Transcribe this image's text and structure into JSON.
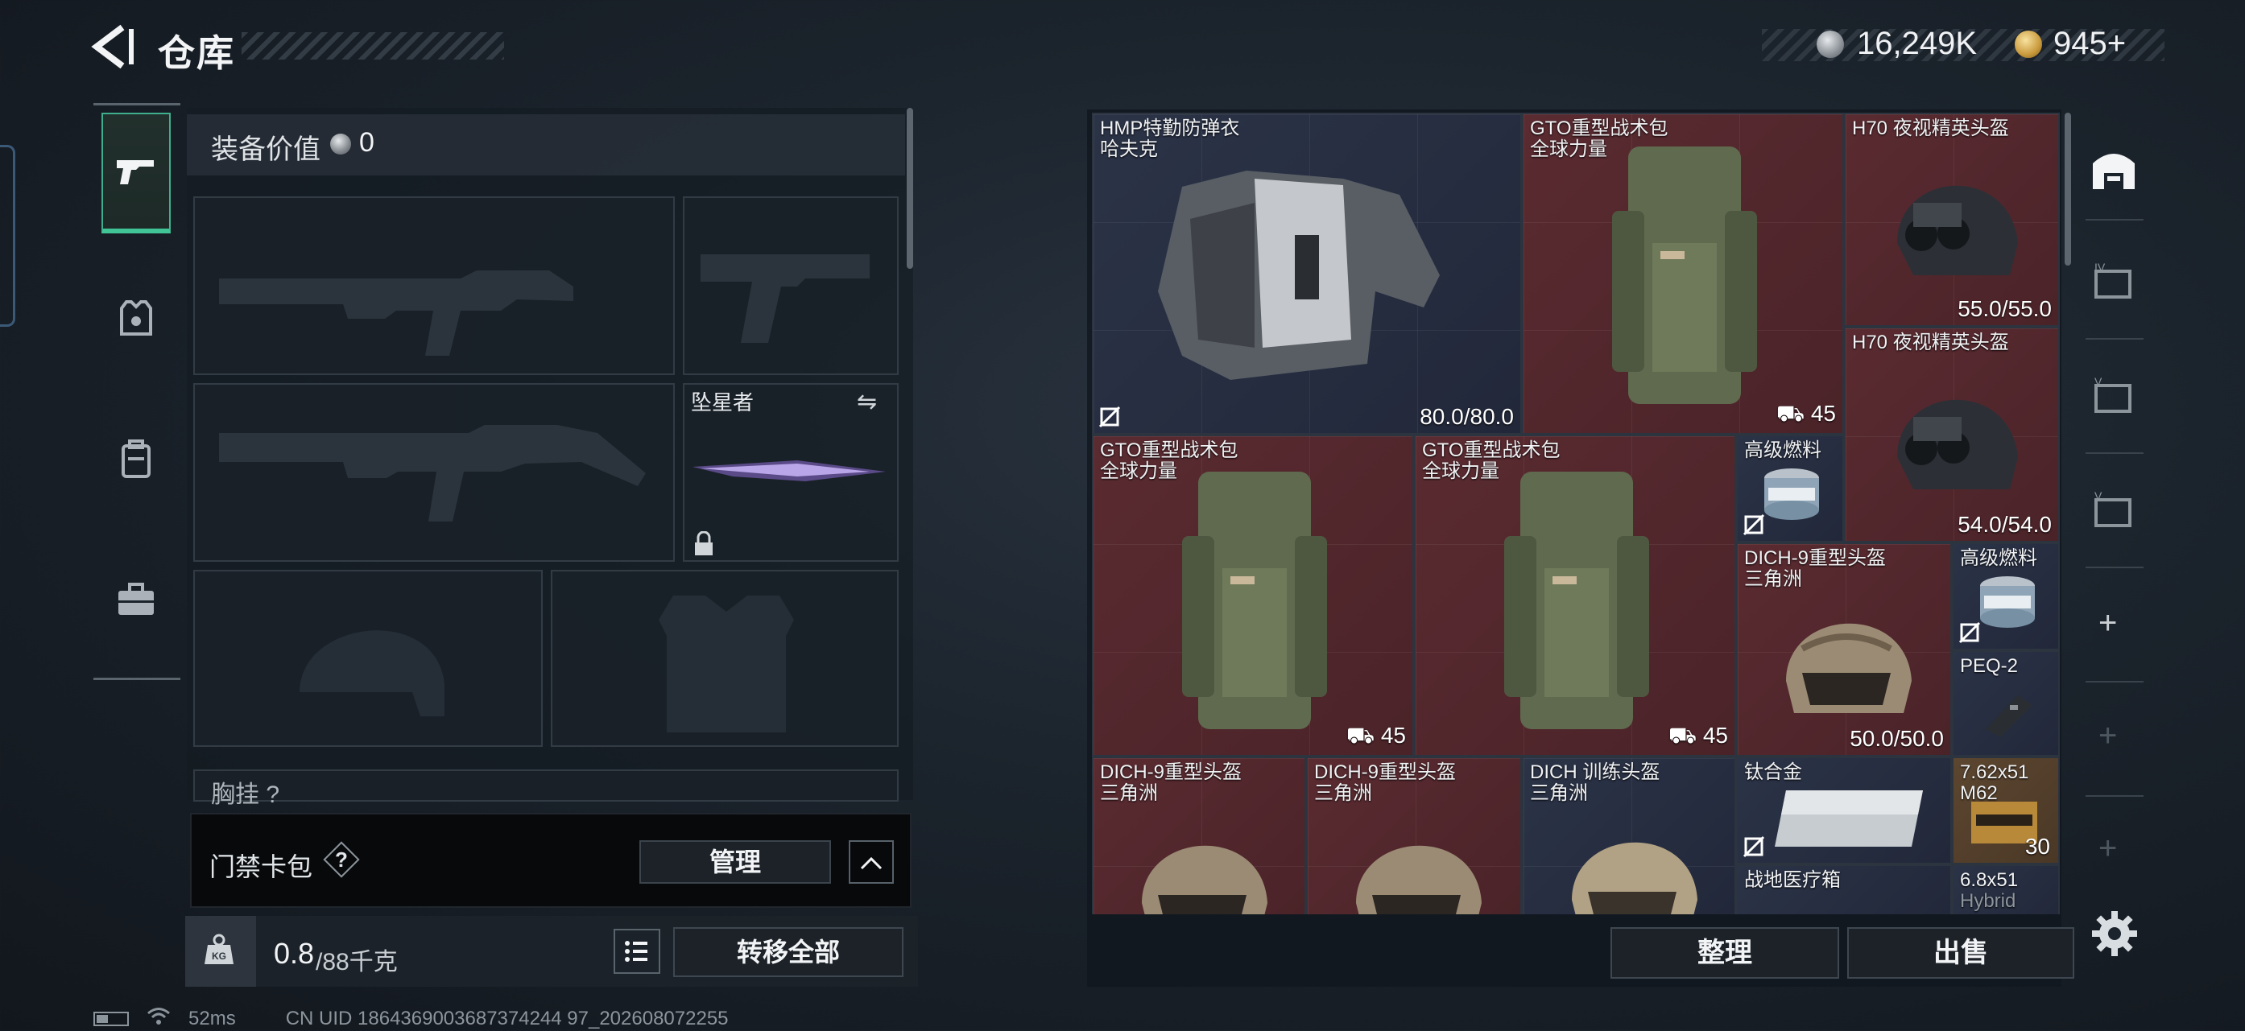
{
  "header": {
    "title": "仓库",
    "currency_silver": "16,249K",
    "currency_gold": "945+"
  },
  "nav": {
    "items": [
      "weapons",
      "armor",
      "backpack",
      "case"
    ]
  },
  "loadout": {
    "title": "装备价值",
    "value": "0",
    "melee_name": "坠星者",
    "chest_label": "胸挂 ?"
  },
  "keycard": {
    "label": "门禁卡包",
    "help": "?",
    "manage": "管理",
    "collapse": "⌃"
  },
  "weight": {
    "current": "0.8",
    "max": "/88千克",
    "transfer": "转移全部"
  },
  "status": {
    "ping": "52ms",
    "uid": "CN UID 1864369003687374244 97_202608072255"
  },
  "stash": {
    "items": [
      {
        "name": "HMP特勤防弹衣",
        "sub": "哈夫克",
        "durability": "80.0/80.0"
      },
      {
        "name": "GTO重型战术包",
        "sub": "全球力量",
        "capacity": "45"
      },
      {
        "name": "H70 夜视精英头盔",
        "sub": "",
        "durability": "55.0/55.0"
      },
      {
        "name": "H70 夜视精英头盔",
        "sub": "",
        "durability": "54.0/54.0"
      },
      {
        "name": "GTO重型战术包",
        "sub": "全球力量",
        "capacity": "45"
      },
      {
        "name": "GTO重型战术包",
        "sub": "全球力量",
        "capacity": "45"
      },
      {
        "name": "高级燃料",
        "sub": ""
      },
      {
        "name": "DICH-9重型头盔",
        "sub": "三角洲",
        "durability": "50.0/50.0"
      },
      {
        "name": "高级燃料",
        "sub": ""
      },
      {
        "name": "PEQ-2",
        "sub": ""
      },
      {
        "name": "DICH-9重型头盔",
        "sub": "三角洲"
      },
      {
        "name": "DICH-9重型头盔",
        "sub": "三角洲"
      },
      {
        "name": "DICH 训练头盔",
        "sub": "三角洲"
      },
      {
        "name": "钛合金",
        "sub": ""
      },
      {
        "name": "7.62x51",
        "sub": "M62",
        "count": "30"
      },
      {
        "name": "战地医疗箱",
        "sub": ""
      },
      {
        "name": "6.8x51",
        "sub": "Hybrid"
      }
    ],
    "sort": "整理",
    "sell": "出售"
  },
  "colors": {
    "accent": "#41c596",
    "rarity_red": "#5a2b31",
    "rarity_blue": "#2b3347",
    "rarity_gold": "#5c4630"
  }
}
